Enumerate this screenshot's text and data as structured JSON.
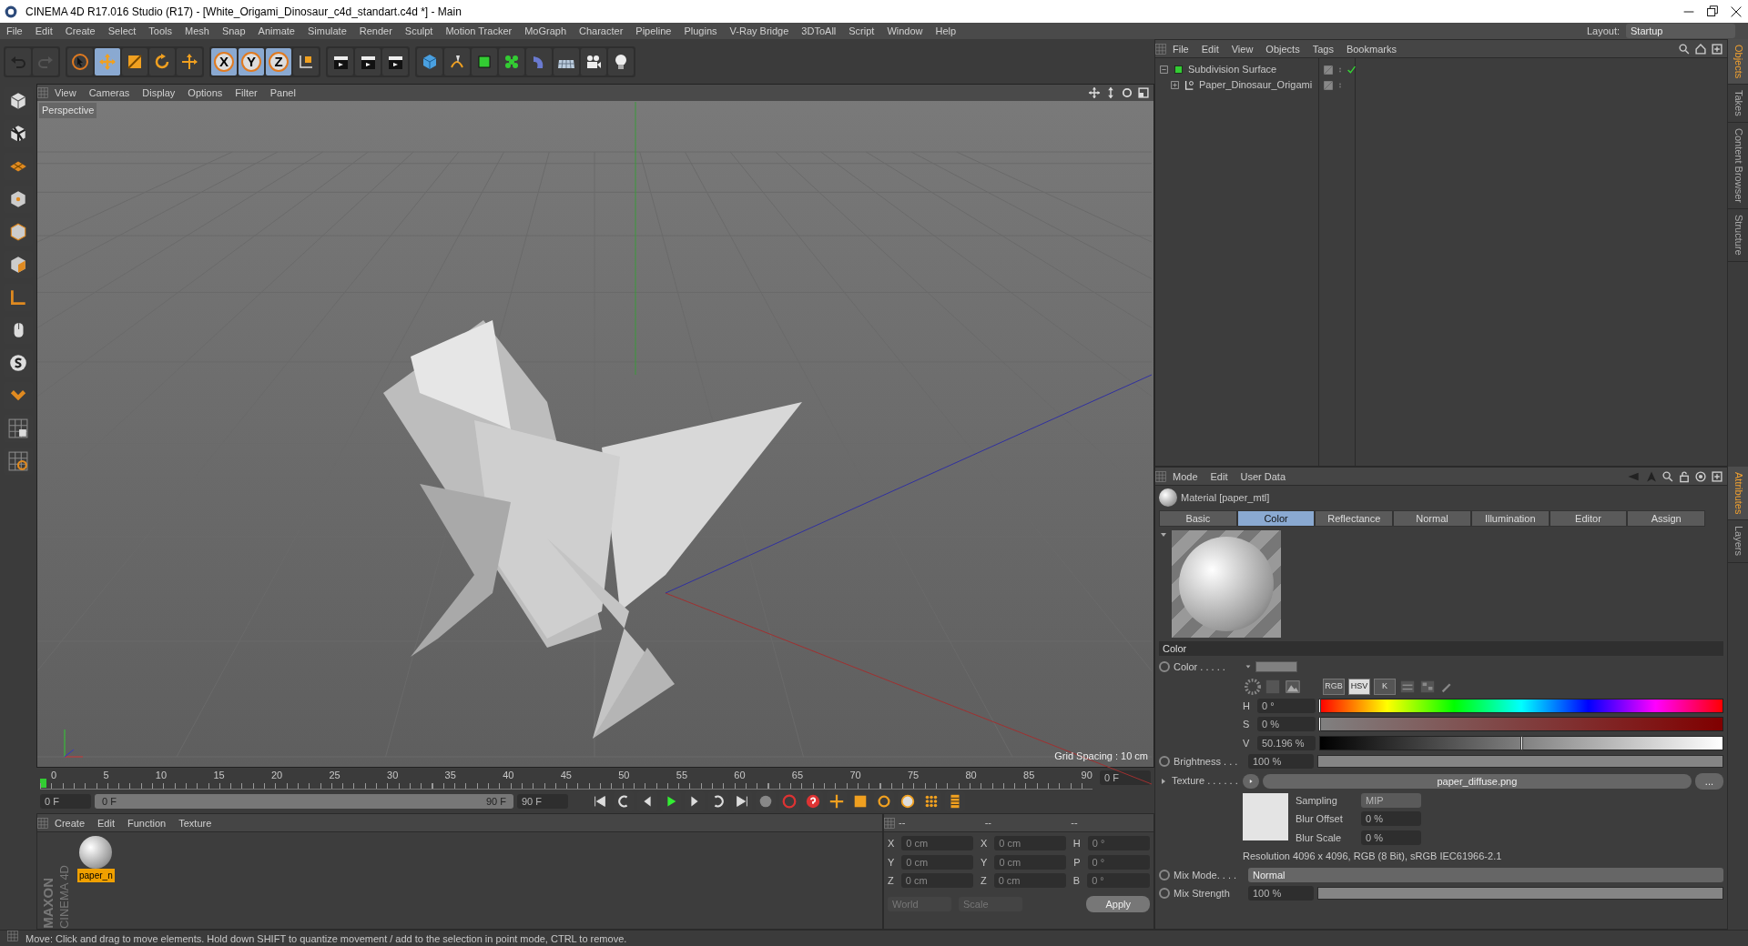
{
  "window": {
    "title": "CINEMA 4D R17.016 Studio (R17) - [White_Origami_Dinosaur_c4d_standart.c4d *] - Main"
  },
  "menu": [
    "File",
    "Edit",
    "Create",
    "Select",
    "Tools",
    "Mesh",
    "Snap",
    "Animate",
    "Simulate",
    "Render",
    "Sculpt",
    "Motion Tracker",
    "MoGraph",
    "Character",
    "Pipeline",
    "Plugins",
    "V-Ray Bridge",
    "3DToAll",
    "Script",
    "Window",
    "Help"
  ],
  "layout": {
    "label": "Layout:",
    "value": "Startup"
  },
  "toolbar": [
    {
      "kind": "undo",
      "selected": false
    },
    {
      "kind": "redo",
      "selected": false
    },
    {
      "kind": "select",
      "selected": false
    },
    {
      "kind": "move",
      "selected": true
    },
    {
      "kind": "scale",
      "selected": false
    },
    {
      "kind": "rotate",
      "selected": false
    },
    {
      "kind": "transform",
      "selected": false
    },
    {
      "kind": "axis",
      "label": "X",
      "selected": true
    },
    {
      "kind": "axis",
      "label": "Y",
      "selected": true
    },
    {
      "kind": "axis",
      "label": "Z",
      "selected": true
    },
    {
      "kind": "coords",
      "selected": false
    },
    {
      "kind": "render",
      "selected": false
    },
    {
      "kind": "render",
      "selected": false
    },
    {
      "kind": "render",
      "selected": false
    },
    {
      "kind": "cube",
      "selected": false
    },
    {
      "kind": "pen",
      "selected": false
    },
    {
      "kind": "subdiv",
      "selected": false
    },
    {
      "kind": "cloner",
      "selected": false
    },
    {
      "kind": "deformer",
      "selected": false
    },
    {
      "kind": "floor",
      "selected": false
    },
    {
      "kind": "camera",
      "selected": false
    },
    {
      "kind": "light",
      "selected": false
    }
  ],
  "viewport": {
    "menu": [
      "View",
      "Cameras",
      "Display",
      "Options",
      "Filter",
      "Panel"
    ],
    "label": "Perspective",
    "grid_spacing": "Grid Spacing : 10 cm"
  },
  "timeline": {
    "ticks": [
      "0",
      "5",
      "10",
      "15",
      "20",
      "25",
      "30",
      "35",
      "40",
      "45",
      "50",
      "55",
      "60",
      "65",
      "70",
      "75",
      "80",
      "85",
      "90"
    ],
    "level": 0,
    "current": "0 F",
    "start": "0 F",
    "range_start": "0 F",
    "range_end": "90 F",
    "end": "90 F"
  },
  "material_manager": {
    "menu": [
      "Create",
      "Edit",
      "Function",
      "Texture"
    ],
    "materials": [
      {
        "name": "paper_n",
        "selected": true
      }
    ]
  },
  "logo": [
    "MAXON",
    "CINEMA 4D"
  ],
  "coordinates": {
    "headers": [
      "--",
      "--",
      "--"
    ],
    "rows": [
      [
        {
          "label": "X",
          "value": "0 cm"
        },
        {
          "label": "X",
          "value": "0 cm"
        },
        {
          "label": "H",
          "value": "0 °"
        }
      ],
      [
        {
          "label": "Y",
          "value": "0 cm"
        },
        {
          "label": "Y",
          "value": "0 cm"
        },
        {
          "label": "P",
          "value": "0 °"
        }
      ],
      [
        {
          "label": "Z",
          "value": "0 cm"
        },
        {
          "label": "Z",
          "value": "0 cm"
        },
        {
          "label": "B",
          "value": "0 °"
        }
      ]
    ],
    "dropdowns": [
      "World",
      "Scale"
    ],
    "apply": "Apply",
    "disabled": true
  },
  "object_manager": {
    "menu": [
      "File",
      "Edit",
      "View",
      "Objects",
      "Tags",
      "Bookmarks"
    ],
    "objects": [
      {
        "name": "Subdivision Surface",
        "expanded": true,
        "checked": true,
        "children": [
          {
            "name": "Paper_Dinosaur_Origami",
            "expanded": false,
            "checked": false
          }
        ]
      }
    ]
  },
  "side_tabs_top": [
    {
      "label": "Objects",
      "selected": true
    },
    {
      "label": "Takes",
      "selected": false
    },
    {
      "label": "Content Browser",
      "selected": false
    },
    {
      "label": "Structure",
      "selected": false
    }
  ],
  "side_tabs_bottom": [
    {
      "label": "Attributes",
      "selected": true
    },
    {
      "label": "Layers",
      "selected": false
    }
  ],
  "attributes": {
    "menu": [
      "Mode",
      "Edit",
      "User Data"
    ],
    "title": "Material [paper_mtl]",
    "tabs": [
      {
        "label": "Basic",
        "selected": false
      },
      {
        "label": "Color",
        "selected": true
      },
      {
        "label": "Reflectance",
        "selected": false
      },
      {
        "label": "Normal",
        "selected": false
      },
      {
        "label": "Illumination",
        "selected": false
      },
      {
        "label": "Editor",
        "selected": false
      },
      {
        "label": "Assign",
        "selected": false
      }
    ],
    "section": "Color",
    "color_label": "Color . . . . .",
    "color_animated": false,
    "color_modes": [
      {
        "label": "RGB",
        "selected": false
      },
      {
        "label": "HSV",
        "selected": true
      },
      {
        "label": "K",
        "selected": false
      }
    ],
    "hsv": [
      {
        "label": "H",
        "value": "0 °",
        "level": 0,
        "kind": "hue"
      },
      {
        "label": "S",
        "value": "0 %",
        "level": 0,
        "kind": "saturation"
      },
      {
        "label": "V",
        "value": "50.196 %",
        "level": 0.50196,
        "kind": "value"
      }
    ],
    "brightness": {
      "label": "Brightness . . .",
      "value": "100 %",
      "level": 1,
      "animated": false
    },
    "texture": {
      "label": "Texture . . . . . .",
      "file": "paper_diffuse.png",
      "browse": "..."
    },
    "sampling": {
      "label": "Sampling",
      "value": "MIP"
    },
    "blur_offset": {
      "label": "Blur Offset",
      "value": "0 %"
    },
    "blur_scale": {
      "label": "Blur Scale",
      "value": "0 %"
    },
    "resolution": "Resolution 4096 x 4096, RGB (8 Bit), sRGB IEC61966-2.1",
    "mix_mode": {
      "label": "Mix Mode. . . .",
      "value": "Normal",
      "animated": false
    },
    "mix_strength": {
      "label": "Mix Strength",
      "value": "100 %",
      "level": 1,
      "animated": false
    }
  },
  "status_bar": "Move: Click and drag to move elements. Hold down SHIFT to quantize movement / add to the selection in point mode, CTRL to remove."
}
